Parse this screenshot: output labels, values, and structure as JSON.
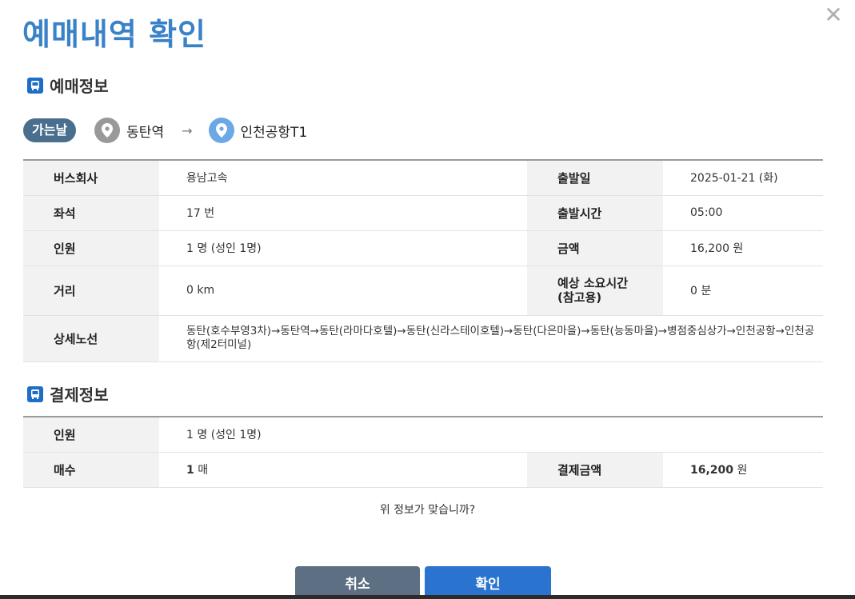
{
  "dialog": {
    "title": "예매내역 확인",
    "close_label": "✕"
  },
  "booking_section": {
    "title": "예매정보"
  },
  "route": {
    "direction": "가는날",
    "from": "동탄역",
    "arrow": "→",
    "to": "인천공항T1"
  },
  "booking_info": {
    "bus_company_label": "버스회사",
    "bus_company": "용남고속",
    "departure_date_label": "출발일",
    "departure_date": "2025-01-21 (화)",
    "seat_label": "좌석",
    "seat": "17 번",
    "departure_time_label": "출발시간",
    "departure_time": "05:00",
    "passengers_label": "인원",
    "passengers": "1 명 (성인 1명)",
    "price_label": "금액",
    "price": "16,200 원",
    "distance_label": "거리",
    "distance": "0 km",
    "duration_label_line1": "예상 소요시간",
    "duration_label_line2": "(참고용)",
    "duration": "0 분",
    "route_detail_label": "상세노선",
    "route_detail": "동탄(호수부영3차)→동탄역→동탄(라마다호텔)→동탄(신라스테이호텔)→동탄(다은마을)→동탄(능동마을)→병점중심상가→인천공항→인천공항(제2터미널)"
  },
  "payment_section": {
    "title": "결제정보"
  },
  "payment_info": {
    "passengers_label": "인원",
    "passengers": "1 명 (성인 1명)",
    "count_label": "매수",
    "count_num": "1",
    "count_unit": " 매",
    "total_label": "결제금액",
    "total_num": "16,200",
    "total_unit": " 원"
  },
  "confirm_question": "위 정보가 맞습니까?",
  "buttons": {
    "cancel": "취소",
    "confirm": "확인"
  },
  "colors": {
    "title": "#3a82c8",
    "badge": "#4a6f8e",
    "confirm_button": "#2a74d0",
    "cancel_button": "#5d6f82"
  }
}
